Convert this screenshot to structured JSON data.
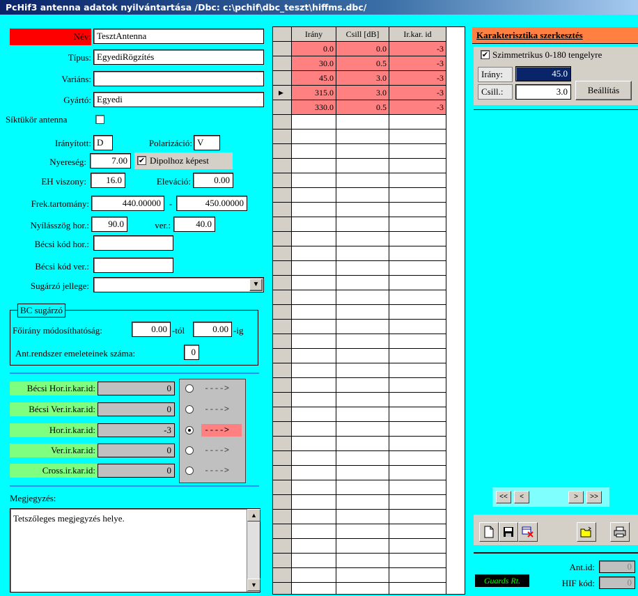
{
  "window": {
    "title": "PcHif3 antenna adatok nyilvántartása   /Dbc: c:\\pchif\\dbc_teszt\\hiffms.dbc/"
  },
  "form": {
    "nev_label": "Név:",
    "nev_value": "TesztAntenna",
    "tipus_label": "Típus:",
    "tipus_value": "EgyediRögzítés",
    "varians_label": "Variáns:",
    "varians_value": "",
    "gyarto_label": "Gyártó:",
    "gyarto_value": "Egyedi",
    "siktukor_label": "Síktükör antenna",
    "iranyitott_label": "Irányított:",
    "iranyitott_value": "D",
    "polarizacio_label": "Polarizáció:",
    "polarizacio_value": "V",
    "nyereseg_label": "Nyereség:",
    "nyereseg_value": "7.00",
    "dipol_label": "Dipolhoz képest",
    "dipol_checked": "✔",
    "eh_label": "EH viszony:",
    "eh_value": "16.0",
    "elevacio_label": "Eleváció:",
    "elevacio_value": "0.00",
    "frek_label": "Frek.tartomány:",
    "frek_from": "440.00000",
    "frek_dash": "-",
    "frek_to": "450.00000",
    "nyilas_label": "Nyílásszög hor.:",
    "nyilas_hor": "90.0",
    "ver_label": "ver.:",
    "nyilas_ver": "40.0",
    "becsi_hor_label": "Bécsi kód hor.:",
    "becsi_hor_value": "",
    "becsi_ver_label": "Bécsi kód ver.:",
    "becsi_ver_value": "",
    "sugarzo_label": "Sugárzó jellege:",
    "sugarzo_value": ""
  },
  "bc": {
    "legend": "BC sugárzó",
    "foirany_label": "Főirány módosíthatóság:",
    "tol_value": "0.00",
    "tol_label": "-tól",
    "ig_value": "0.00",
    "ig_label": "-ig",
    "emelet_label": "Ant.rendszer emeleteinek száma:",
    "emelet_value": "0"
  },
  "karid": [
    {
      "label": "Bécsi Hor.ir.kar.id:",
      "value": "0",
      "arrow": "---->",
      "selected": false
    },
    {
      "label": "Bécsi Ver.ir.kar.id:",
      "value": "0",
      "arrow": "---->",
      "selected": false
    },
    {
      "label": "Hor.ir.kar.id:",
      "value": "-3",
      "arrow": "---->",
      "selected": true
    },
    {
      "label": "Ver.ir.kar.id:",
      "value": "0",
      "arrow": "---->",
      "selected": false
    },
    {
      "label": "Cross.ir.kar.id:",
      "value": "0",
      "arrow": "---->",
      "selected": false
    }
  ],
  "megjegyzes": {
    "label": "Megjegyzés:",
    "value": "Tetszőleges megjegyzés helye."
  },
  "grid": {
    "headers": [
      "Irány",
      "Csill [dB]",
      "Ir.kar. id"
    ],
    "rows": [
      [
        "0.0",
        "0.0",
        "-3"
      ],
      [
        "30.0",
        "0.5",
        "-3"
      ],
      [
        "45.0",
        "3.0",
        "-3"
      ],
      [
        "315.0",
        "3.0",
        "-3"
      ],
      [
        "330.0",
        "0.5",
        "-3"
      ]
    ],
    "current_row": 3
  },
  "editor": {
    "title": "Karakterisztika szerkesztés",
    "szimm_label": "Szimmetrikus 0-180 tengelyre",
    "szimm_checked": "✔",
    "irany_label": "Irány:",
    "irany_value": "45.0",
    "csill_label": "Csill.:",
    "csill_value": "3.0",
    "beallitas": "Beállítás"
  },
  "nav": {
    "first": "<<",
    "prev": "<",
    "next": ">",
    "last": ">>"
  },
  "footer": {
    "company": "Guards Rt.",
    "antid_label": "Ant.id:",
    "antid_value": "0",
    "hif_label": "HIF kód:",
    "hif_value": "0"
  }
}
